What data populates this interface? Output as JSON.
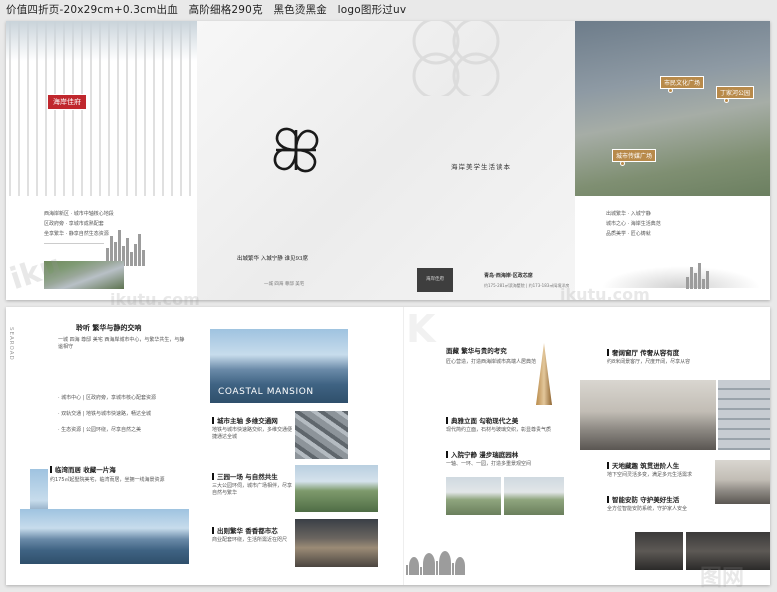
{
  "header": {
    "text": "价值四折页-20x29cm+0.3cm出血　高阶细格290克　黑色烫黑金　logo图形过uv"
  },
  "top_spread": {
    "logo_badge": "海岸佳府",
    "center_tagline": "海岸美学生活读本",
    "center_slogan": "出城繁华 入城宁静 谁见93席",
    "center_small": "一城 四海 尊邸 美宅",
    "center_bottom_logo": "海岸佳府",
    "center_location": "青岛·西海岸·区政芯席",
    "center_area": "约175-281㎡滨海墅院 | 约173-183㎡阔境洋房",
    "map_labels": [
      "市民文化广场",
      "丁家河公园",
      "城市传媒广场"
    ],
    "left_lines": [
      "西海岸新区 · 城市中轴核心地段",
      "区政府旁 · 享城市成熟配套",
      "坐享繁华 · 静享自然生态资源"
    ],
    "right_lines": [
      "出城繁华 · 入城宁静",
      "城市之心 · 海岸生活典范",
      "品质美学 · 匠心铸就"
    ]
  },
  "bottom_left_page": {
    "vertical_label": "SEAROAD",
    "heading": "聆听 繁华与静的交响",
    "heading_sub": "一城 四海 尊邸 美宅 西海岸城市中心，与繁华共生，与静谧相守",
    "points": [
      "· 城市中心 | 区政府旁，享城市核心配套资源",
      "· 双轨交通 | 地铁与城市快速路，畅达全城",
      "· 生态资源 | 公园环绕，尽享自然之美"
    ],
    "section_title": "临湾而居 收藏一片海",
    "section_body": "约175㎡起墅院美宅，临湾而居，坐拥一线海景资源"
  },
  "bottom_mid_page": {
    "banner": "COASTAL MANSION",
    "items": [
      {
        "title": "城市主轴 多维交通网",
        "body": "地铁与城市快速路交织，多维交通便捷通达全城"
      },
      {
        "title": "三园一场 与自然共生",
        "body": "三大公园环伺，城市广场相伴，尽享自然与繁华"
      },
      {
        "title": "出则繁华 香香都市芯",
        "body": "商业配套环绕，生活所需近在咫尺"
      }
    ]
  },
  "bottom_right_left_page": {
    "heading": "面藏 繁华与贵的考究",
    "heading_body": "匠心营造，打造西海岸城市高端人居典范",
    "items": [
      {
        "title": "典雅立面 勾勒现代之美",
        "body": "现代简约立面，石材与玻璃交织，彰显尊贵气质"
      },
      {
        "title": "入院宁静 漫步瑞庭园林",
        "body": "一轴、一环、一园，打造多重景观空间"
      }
    ]
  },
  "bottom_right_page": {
    "items": [
      {
        "title": "奢阔窗厅 传奢从容有度",
        "body": "约8米阔景客厅，尺度开阔，尽享从容"
      },
      {
        "title": "天地藏趣 筑贯进阶人生",
        "body": "地下空间灵活多变，满足多元生活需求"
      },
      {
        "title": "智能安防 守护美好生活",
        "body": "全方位智能安防系统，守护家人安全"
      }
    ]
  },
  "watermarks": [
    "iku",
    "ikutu.com",
    "图网"
  ]
}
